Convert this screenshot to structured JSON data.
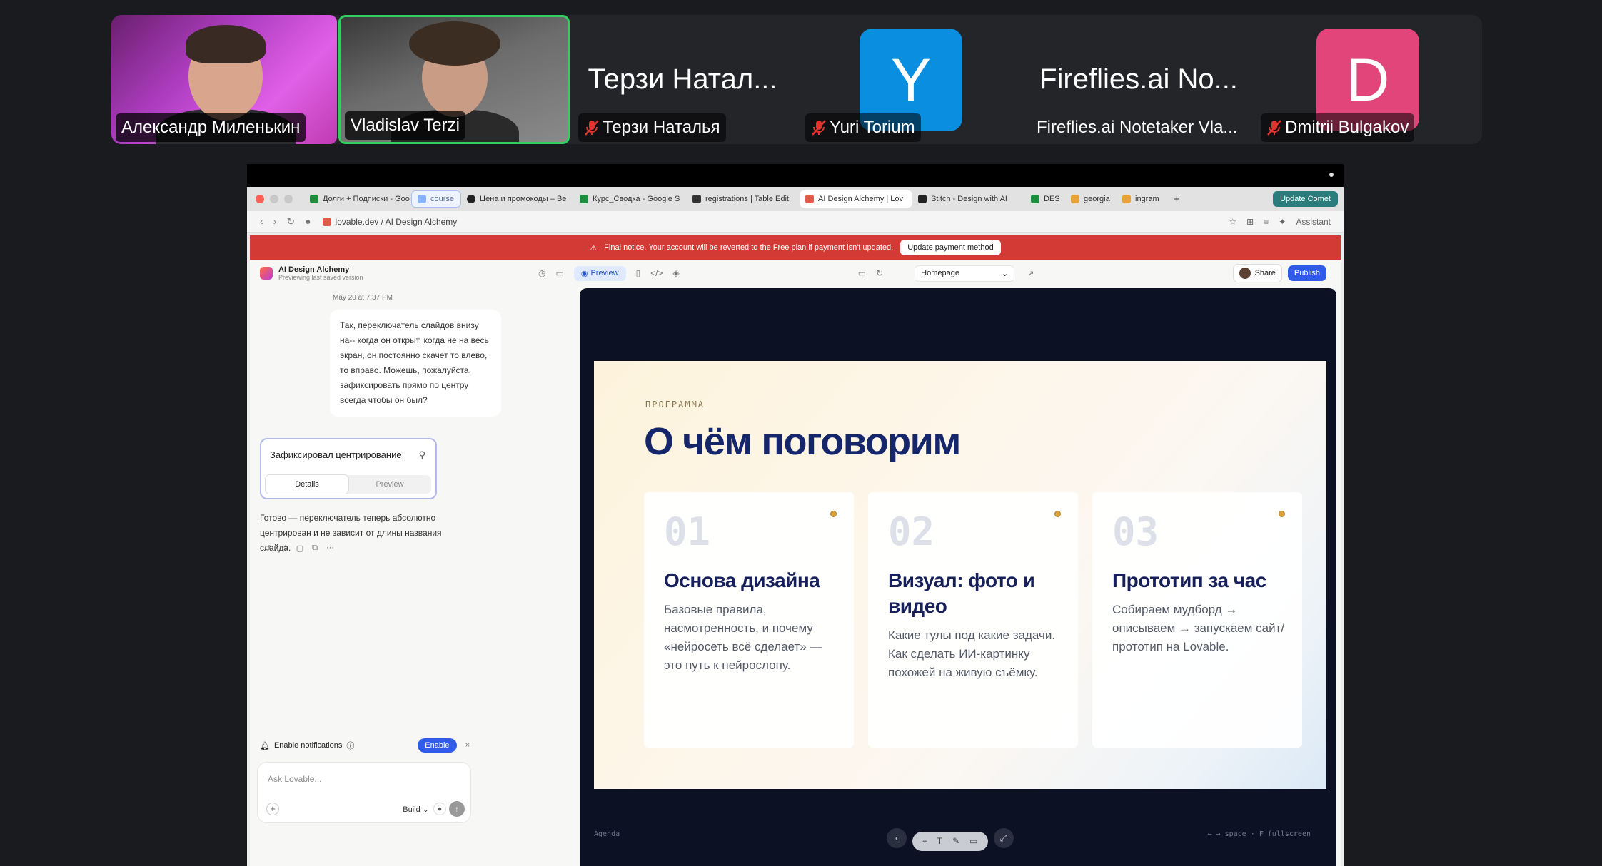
{
  "participants": [
    {
      "name": "Александр Миленькин",
      "muted": false
    },
    {
      "name": "Vladislav Terzi",
      "muted": false,
      "active_speaker": true
    },
    {
      "big_label": "Терзи Натал...",
      "name": "Терзи Наталья",
      "muted": true
    },
    {
      "avatar_letter": "Y",
      "avatar_color": "#0a8fe0",
      "name": "Yuri Torium",
      "muted": true
    },
    {
      "big_label": "Fireflies.ai No...",
      "name": "Fireflies.ai Notetaker Vla...",
      "muted": false
    },
    {
      "avatar_letter": "D",
      "avatar_color": "#e2457a",
      "name": "Dmitrii Bulgakov",
      "muted": true
    }
  ],
  "browser": {
    "tabs": [
      {
        "label": "Долги + Подписки - Goo",
        "color": "#1e8e3e"
      },
      {
        "label": "course",
        "color": "#8ab4f8"
      },
      {
        "label": "Цена и промокоды – Be",
        "color": "#222222"
      },
      {
        "label": "Курс_Сводка - Google S",
        "color": "#1e8e3e"
      },
      {
        "label": "registrations | Table Edit",
        "color": "#333333"
      },
      {
        "label": "AI Design Alchemy | Lov",
        "color": "#e0594a",
        "active": true
      },
      {
        "label": "Stitch - Design with AI",
        "color": "#222222"
      },
      {
        "label": "DES",
        "color": "#1e8e3e"
      },
      {
        "label": "georgia",
        "color": "#e8a23b"
      },
      {
        "label": "ingram",
        "color": "#e8a23b"
      }
    ],
    "new_tab": "+",
    "update_button": "Update Comet",
    "url": "lovable.dev / AI Design Alchemy",
    "assistant": "Assistant"
  },
  "banner": {
    "text": "Final notice. Your account will be reverted to the Free plan if payment isn't updated.",
    "button": "Update payment method"
  },
  "app": {
    "project_name": "AI Design Alchemy",
    "project_sub": "Previewing last saved version",
    "preview_label": "Preview",
    "page_select": "Homepage",
    "share": "Share",
    "publish": "Publish"
  },
  "chat": {
    "date": "May 20 at 7:37 PM",
    "user_message": "Так, переключатель слайдов внизу на-- когда он открыт, когда не на весь экран, он постоянно скачет то влево, то вправо. Можешь, пожалуйста, зафиксировать прямо по центру всегда чтобы он был?",
    "card_title": "Зафиксировал центрирование",
    "card_tab_details": "Details",
    "card_tab_preview": "Preview",
    "answer": "Готово — переключатель теперь абсолютно центрирован и не зависит от длины названия слайда.",
    "notifications_label": "Enable notifications",
    "enable_button": "Enable",
    "ask_placeholder": "Ask Lovable...",
    "build_mode": "Build"
  },
  "slide": {
    "kicker": "ПРОГРАММА",
    "title": "О чём поговорим",
    "cards": [
      {
        "num": "01",
        "title": "Основа дизайна",
        "desc": "Базовые правила, насмотренность, и почему «нейросеть всё сделает» — это путь к нейрослопу."
      },
      {
        "num": "02",
        "title": "Визуал: фото и видео",
        "desc": "Какие тулы под какие задачи. Как сделать ИИ-картинку похожей на живую съёмку."
      },
      {
        "num": "03",
        "title": "Прототип за час",
        "desc": "Собираем мудборд → описываем → запускаем сайт/прототип на Lovable."
      }
    ],
    "footer_left": "Agenda",
    "footer_right": "← → space · F fullscreen"
  }
}
